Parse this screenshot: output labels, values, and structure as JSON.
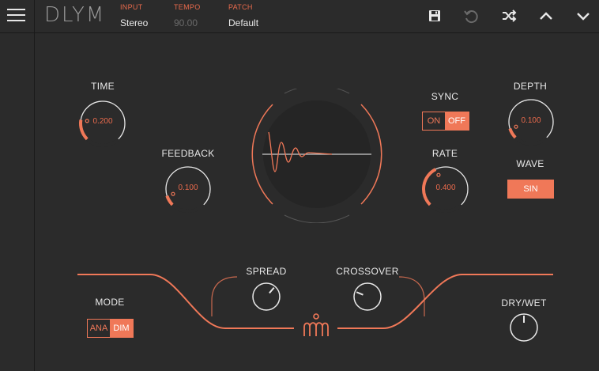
{
  "app": {
    "logo": "DLYM"
  },
  "header": {
    "input": {
      "label": "INPUT",
      "value": "Stereo"
    },
    "tempo": {
      "label": "TEMPO",
      "value": "90.00"
    },
    "patch": {
      "label": "PATCH",
      "value": "Default"
    }
  },
  "toolbar_icons": [
    "save-icon",
    "undo-icon",
    "shuffle-icon",
    "chevron-up-icon",
    "chevron-down-icon"
  ],
  "knobs": {
    "time": {
      "label": "TIME",
      "value": "0.200",
      "level": 0.2
    },
    "feedback": {
      "label": "FEEDBACK",
      "value": "0.100",
      "level": 0.1
    },
    "rate": {
      "label": "RATE",
      "value": "0.400",
      "level": 0.4
    },
    "depth": {
      "label": "DEPTH",
      "value": "0.100",
      "level": 0.1
    },
    "spread": {
      "label": "SPREAD",
      "level": 0.65
    },
    "crossover": {
      "label": "CROSSOVER",
      "level": 0.25
    },
    "drywet": {
      "label": "DRY/WET",
      "level": 0.5
    }
  },
  "sync": {
    "label": "SYNC",
    "on": "ON",
    "off": "OFF",
    "selected": "OFF"
  },
  "wave": {
    "label": "WAVE",
    "value": "SIN"
  },
  "mode": {
    "label": "MODE",
    "a": "ANA",
    "b": "DIM",
    "selected": "DIM"
  },
  "colors": {
    "accent": "#f07858",
    "background": "#2b2b2b",
    "text": "#e8e8e8"
  }
}
